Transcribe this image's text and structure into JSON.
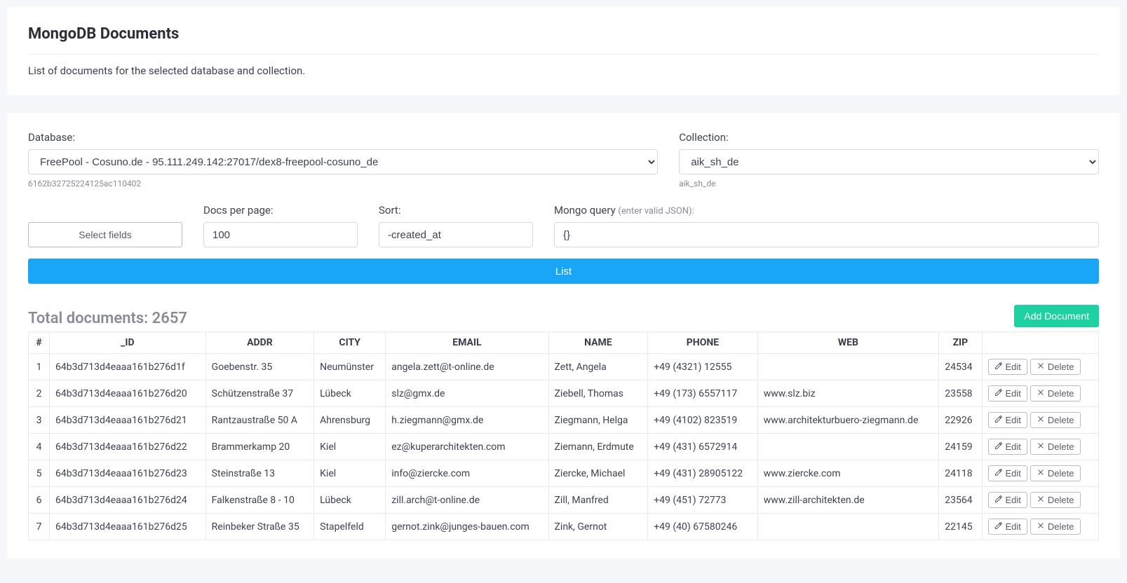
{
  "header": {
    "title": "MongoDB Documents",
    "subtitle": "List of documents for the selected database and collection."
  },
  "selectors": {
    "database_label": "Database:",
    "database_value": "FreePool - Cosuno.de - 95.111.249.142:27017/dex8-freepool-cosuno_de",
    "database_hint": "6162b32725224125ac110402",
    "collection_label": "Collection:",
    "collection_value": "aik_sh_de",
    "collection_hint": "aik_sh_de"
  },
  "filters": {
    "select_fields_label": "Select fields",
    "perpage_label": "Docs per page:",
    "perpage_value": "100",
    "sort_label": "Sort:",
    "sort_value": "-created_at",
    "query_label": "Mongo query ",
    "query_label_note": "(enter valid JSON):",
    "query_value": "{}",
    "list_button": "List"
  },
  "results": {
    "total_label": "Total documents: 2657",
    "add_button": "Add Document",
    "columns": [
      "#",
      "_ID",
      "ADDR",
      "CITY",
      "EMAIL",
      "NAME",
      "PHONE",
      "WEB",
      "ZIP",
      ""
    ],
    "edit_label": "Edit",
    "delete_label": "Delete",
    "rows": [
      {
        "n": "1",
        "_id": "64b3d713d4eaaa161b276d1f",
        "addr": "Goebenstr. 35",
        "city": "Neumünster",
        "email": "angela.zett@t-online.de",
        "name": "Zett, Angela",
        "phone": "+49 (4321) 12555",
        "web": "",
        "zip": "24534"
      },
      {
        "n": "2",
        "_id": "64b3d713d4eaaa161b276d20",
        "addr": "Schützenstraße 37",
        "city": "Lübeck",
        "email": "slz@gmx.de",
        "name": "Ziebell, Thomas",
        "phone": "+49 (173) 6557117",
        "web": "www.slz.biz",
        "zip": "23558"
      },
      {
        "n": "3",
        "_id": "64b3d713d4eaaa161b276d21",
        "addr": "Rantzaustraße 50 A",
        "city": "Ahrensburg",
        "email": "h.ziegmann@gmx.de",
        "name": "Ziegmann, Helga",
        "phone": "+49 (4102) 823519",
        "web": "www.architekturbuero-ziegmann.de",
        "zip": "22926"
      },
      {
        "n": "4",
        "_id": "64b3d713d4eaaa161b276d22",
        "addr": "Brammerkamp 20",
        "city": "Kiel",
        "email": "ez@kuperarchitekten.com",
        "name": "Ziemann, Erdmute",
        "phone": "+49 (431) 6572914",
        "web": "",
        "zip": "24159"
      },
      {
        "n": "5",
        "_id": "64b3d713d4eaaa161b276d23",
        "addr": "Steinstraße 13",
        "city": "Kiel",
        "email": "info@ziercke.com",
        "name": "Ziercke, Michael",
        "phone": "+49 (431) 28905122",
        "web": "www.ziercke.com",
        "zip": "24118"
      },
      {
        "n": "6",
        "_id": "64b3d713d4eaaa161b276d24",
        "addr": "Falkenstraße 8 - 10",
        "city": "Lübeck",
        "email": "zill.arch@t-online.de",
        "name": "Zill, Manfred",
        "phone": "+49 (451) 72773",
        "web": "www.zill-architekten.de",
        "zip": "23564"
      },
      {
        "n": "7",
        "_id": "64b3d713d4eaaa161b276d25",
        "addr": "Reinbeker Straße 35",
        "city": "Stapelfeld",
        "email": "gernot.zink@junges-bauen.com",
        "name": "Zink, Gernot",
        "phone": "+49 (40) 67580246",
        "web": "",
        "zip": "22145"
      }
    ]
  }
}
